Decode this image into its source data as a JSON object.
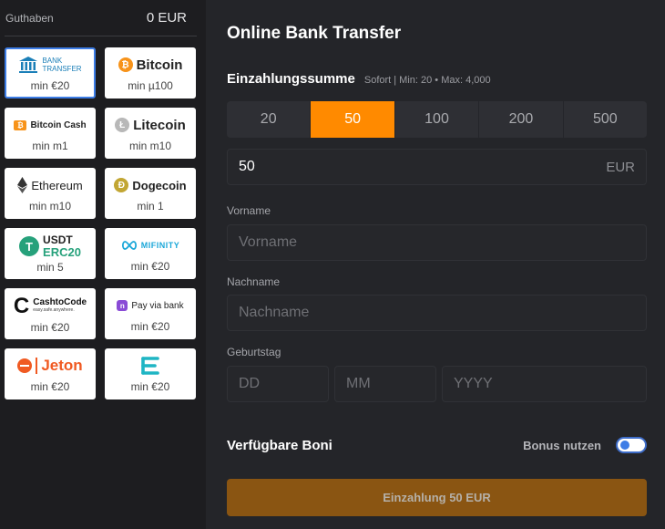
{
  "sidebar": {
    "balance_label": "Guthaben",
    "balance_value": "0 EUR",
    "methods": [
      {
        "name": "BANK TRANSFER",
        "line1": "BANK",
        "line2": "TRANSFER",
        "min": "min €20"
      },
      {
        "name": "Bitcoin",
        "min": "min µ100"
      },
      {
        "name": "Bitcoin Cash",
        "min": "min m1"
      },
      {
        "name": "Litecoin",
        "min": "min m10"
      },
      {
        "name": "Ethereum",
        "min": "min m10"
      },
      {
        "name": "Dogecoin",
        "min": "min 1"
      },
      {
        "name": "USDT ERC20",
        "line1": "USDT",
        "line2": "ERC20",
        "min": "min 5"
      },
      {
        "name": "MIFINITY",
        "min": "min €20"
      },
      {
        "name": "CashtoCode",
        "line1": "CashtoCode",
        "line2": "easy.safe.anywhere.",
        "min": "min €20"
      },
      {
        "name": "Pay via bank",
        "min": "min €20"
      },
      {
        "name": "Jeton",
        "min": "min €20"
      },
      {
        "name": "",
        "min": "min €20"
      }
    ]
  },
  "main": {
    "title": "Online Bank Transfer",
    "amount_title": "Einzahlungssumme",
    "amount_info": "Sofort | Min: 20 • Max: 4,000",
    "presets": [
      "20",
      "50",
      "100",
      "200",
      "500"
    ],
    "amount_value": "50",
    "currency": "EUR",
    "first_name_label": "Vorname",
    "first_name_placeholder": "Vorname",
    "last_name_label": "Nachname",
    "last_name_placeholder": "Nachname",
    "birthday_label": "Geburtstag",
    "dd_placeholder": "DD",
    "mm_placeholder": "MM",
    "yyyy_placeholder": "YYYY",
    "bonus_title": "Verfügbare Boni",
    "bonus_toggle_label": "Bonus nutzen",
    "submit_label": "Einzahlung 50 EUR"
  },
  "colors": {
    "accent_orange": "#ff8a00",
    "selected_blue": "#3d7de6",
    "submit_bg": "#8a5512"
  }
}
